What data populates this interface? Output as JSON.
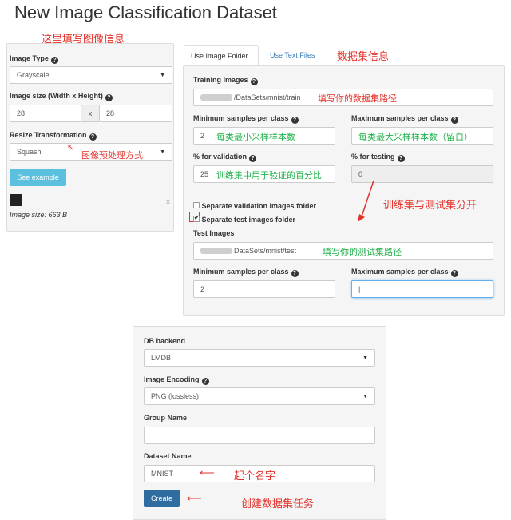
{
  "page": {
    "title": "New Image Classification Dataset"
  },
  "annotations": {
    "image_info": "这里填写图像信息",
    "dataset_info": "数据集信息",
    "train_path": "填写你的数据集路径",
    "min_samples": "每类最小采样样本数",
    "max_samples": "每类最大采样样本数（留白）",
    "validation": "训练集中用于验证的百分比",
    "split": "训练集与测试集分开",
    "test_path": "填写你的测试集路径",
    "resize": "图像预处理方式",
    "name": "起个名字",
    "create": "创建数据集任务"
  },
  "left": {
    "image_type_label": "Image Type",
    "image_type_value": "Grayscale",
    "image_size_label": "Image size (Width x Height)",
    "width": "28",
    "x": "x",
    "height": "28",
    "resize_label": "Resize Transformation",
    "resize_value": "Squash",
    "example_button": "See example",
    "image_size_text": "Image size: 663 B",
    "close": "×"
  },
  "tabs": {
    "folder": "Use Image Folder",
    "text": "Use Text Files"
  },
  "right": {
    "training_label": "Training Images",
    "training_path": "/DataSets/mnist/train",
    "min_label": "Minimum samples per class",
    "min_value": "2",
    "max_label": "Maximum samples per class",
    "val_label": "% for validation",
    "val_value": "25",
    "test_pct_label": "% for testing",
    "test_pct_value": "0",
    "sep_val_label": "Separate validation images folder",
    "sep_test_label": "Separate test images folder",
    "test_images_label": "Test Images",
    "test_path": "DataSets/mnist/test",
    "min2_label": "Minimum samples per class",
    "min2_value": "2",
    "max2_label": "Maximum samples per class",
    "max2_value": "|"
  },
  "bottom": {
    "db_label": "DB backend",
    "db_value": "LMDB",
    "enc_label": "Image Encoding",
    "enc_value": "PNG (lossless)",
    "group_label": "Group Name",
    "group_value": "",
    "name_label": "Dataset Name",
    "name_value": "MNIST",
    "create_button": "Create"
  }
}
